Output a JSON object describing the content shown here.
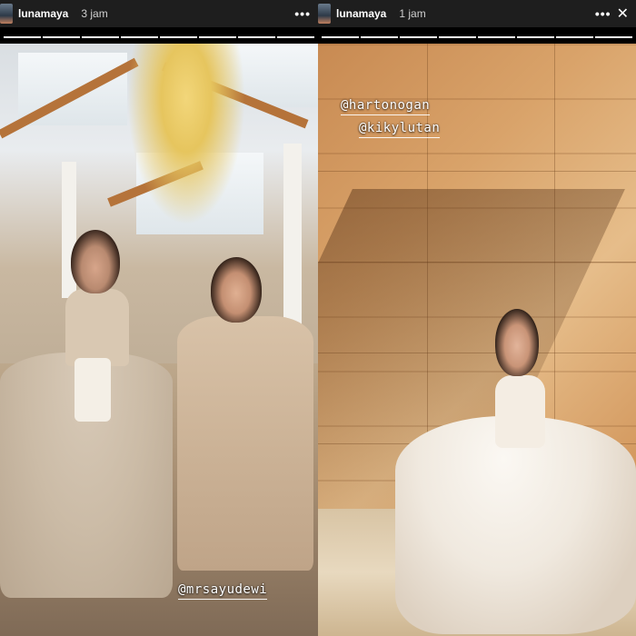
{
  "stories": [
    {
      "username": "lunamaya",
      "time": "3 jam",
      "progress": {
        "total": 8,
        "done": 8
      },
      "mentions": [
        "@mrsayudewi"
      ]
    },
    {
      "username": "lunamaya",
      "time": "1 jam",
      "progress": {
        "total": 8,
        "done": 8
      },
      "mentions": [
        "@hartonogan",
        "@kikylutan"
      ]
    }
  ],
  "icons": {
    "more": "more-horizontal-icon",
    "close": "close-icon"
  },
  "symbols": {
    "more": "•••",
    "close": "✕"
  },
  "colors": {
    "header_bg": "#1e1e1e",
    "mention_text": "#ffffff"
  }
}
